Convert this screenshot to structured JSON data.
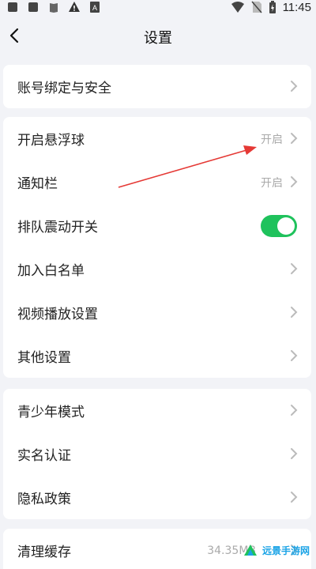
{
  "status_bar": {
    "time": "11:45",
    "icons": [
      "notification-square-icon",
      "notification-square-icon",
      "book-icon",
      "warning-icon",
      "font-icon",
      "wifi-icon",
      "no-sim-icon",
      "battery-icon"
    ]
  },
  "nav": {
    "title": "设置"
  },
  "sections": {
    "account": {
      "label": "账号绑定与安全"
    },
    "float_ball": {
      "label": "开启悬浮球",
      "value": "开启"
    },
    "notification_bar": {
      "label": "通知栏",
      "value": "开启"
    },
    "queue_vibrate": {
      "label": "排队震动开关",
      "toggle_on": true
    },
    "whitelist": {
      "label": "加入白名单"
    },
    "video_play": {
      "label": "视频播放设置"
    },
    "other": {
      "label": "其他设置"
    },
    "teen_mode": {
      "label": "青少年模式"
    },
    "real_name": {
      "label": "实名认证"
    },
    "privacy": {
      "label": "隐私政策"
    },
    "clear_cache": {
      "label": "清理缓存",
      "value": "34.35MB"
    }
  },
  "watermark": {
    "text": "远景手游网"
  },
  "colors": {
    "accent_green": "#1fc25c",
    "annotation_red": "#e53935",
    "background": "#f2f3f7"
  }
}
